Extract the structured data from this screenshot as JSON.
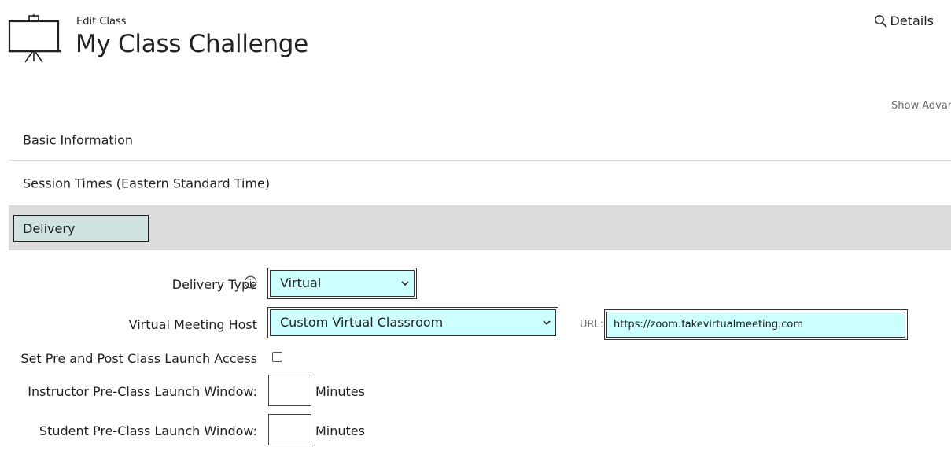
{
  "header": {
    "pre_title": "Edit Class",
    "title": "My Class Challenge",
    "details_label": "Details"
  },
  "show_advanced_label": "Show Advan",
  "sections": {
    "basic": "Basic Information",
    "session": "Session Times (Eastern Standard Time)",
    "delivery": "Delivery"
  },
  "form": {
    "delivery_type_label": "Delivery Type",
    "delivery_type_value": "Virtual",
    "meeting_host_label": "Virtual Meeting Host",
    "meeting_host_value": "Custom Virtual Classroom",
    "url_label": "URL:",
    "url_value": "https://zoom.fakevirtualmeeting.com",
    "launch_access_label": "Set Pre and Post Class Launch Access",
    "launch_access_checked": false,
    "instructor_window_label": "Instructor Pre-Class Launch Window:",
    "instructor_window_value": "",
    "student_window_label": "Student Pre-Class Launch Window:",
    "student_window_value": "",
    "minutes_label": "Minutes"
  },
  "icons": {
    "class": "presentation-board-icon",
    "details": "search-icon",
    "info": "info-icon",
    "dropdown": "chevron-down-icon"
  },
  "colors": {
    "field_bg": "#ccffff",
    "active_tab_bg": "#cfe1e1",
    "section_bg": "#dcdcdc"
  }
}
